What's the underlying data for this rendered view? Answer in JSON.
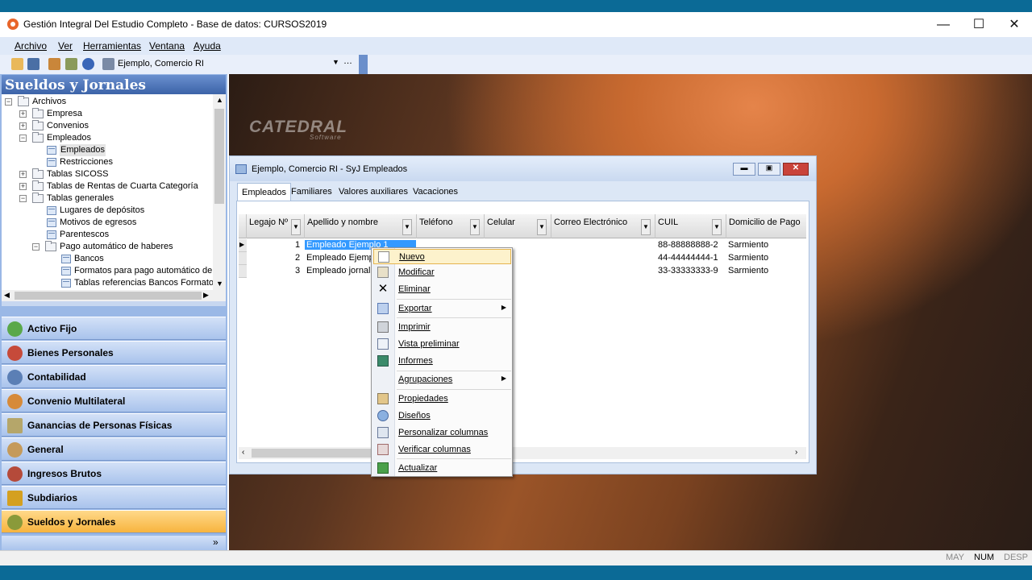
{
  "window": {
    "title": "Gestión Integral Del Estudio Completo - Base de datos: CURSOS2019",
    "min": "—",
    "max": "☐",
    "close": "✕"
  },
  "menu": [
    "Archivo",
    "Ver",
    "Herramientas",
    "Ventana",
    "Ayuda"
  ],
  "toolbar": {
    "company_combo": "Ejemplo, Comercio RI",
    "combo_more": "…"
  },
  "nav": {
    "header": "Sueldos y Jornales",
    "tree": {
      "archivos": "Archivos",
      "empresa": "Empresa",
      "convenios": "Convenios",
      "empleados": "Empleados",
      "empleados_child": "Empleados",
      "restricciones": "Restricciones",
      "sicoss": "Tablas SICOSS",
      "rentas": "Tablas de Rentas de Cuarta Categoría",
      "generales": "Tablas generales",
      "lugares": "Lugares de depósitos",
      "motivos": "Motivos de egresos",
      "parentescos": "Parentescos",
      "pago": "Pago automático de haberes",
      "bancos": "Bancos",
      "formatos": "Formatos para pago automático de ha",
      "referencias": "Tablas referencias Bancos Formatos"
    },
    "modules": [
      "Activo Fijo",
      "Bienes Personales",
      "Contabilidad",
      "Convenio Multilateral",
      "Ganancias de Personas Físicas",
      "General",
      "Ingresos Brutos",
      "Subdiarios",
      "Sueldos y Jornales"
    ],
    "colors": [
      "#5aa84a",
      "#c64a3a",
      "#5b7fb5",
      "#d68a3a",
      "#b5a66a",
      "#c59a5a",
      "#b54a3a",
      "#d4a020",
      "#8a9a3a"
    ],
    "more": "»"
  },
  "desktop": {
    "logo": "CATEDRAL",
    "logo_sub": "Software"
  },
  "child": {
    "title": "Ejemplo, Comercio RI - SyJ Empleados",
    "tabs": [
      "Empleados",
      "Familiares",
      "Valores auxiliares",
      "Vacaciones"
    ],
    "columns": [
      "Legajo Nº",
      "Apellido y nombre",
      "Teléfono",
      "Celular",
      "Correo Electrónico",
      "CUIL",
      "Domicilio de Pago"
    ],
    "rows": [
      {
        "legajo": "1",
        "nombre": "Empleado Ejemplo 1",
        "cuil": "88-88888888-2",
        "domicilio": "Sarmiento"
      },
      {
        "legajo": "2",
        "nombre": "Empleado Ejemplo",
        "cuil": "44-44444444-1",
        "domicilio": "Sarmiento"
      },
      {
        "legajo": "3",
        "nombre": "Empleado jornaliza",
        "cuil": "33-33333333-9",
        "domicilio": "Sarmiento"
      }
    ]
  },
  "context_menu": [
    "Nuevo",
    "Modificar",
    "Eliminar",
    "Exportar",
    "Imprimir",
    "Vista preliminar",
    "Informes",
    "Agrupaciones",
    "Propiedades",
    "Diseños",
    "Personalizar columnas",
    "Verificar columnas",
    "Actualizar"
  ],
  "status": {
    "may": "MAY",
    "num": "NUM",
    "desp": "DESP"
  }
}
